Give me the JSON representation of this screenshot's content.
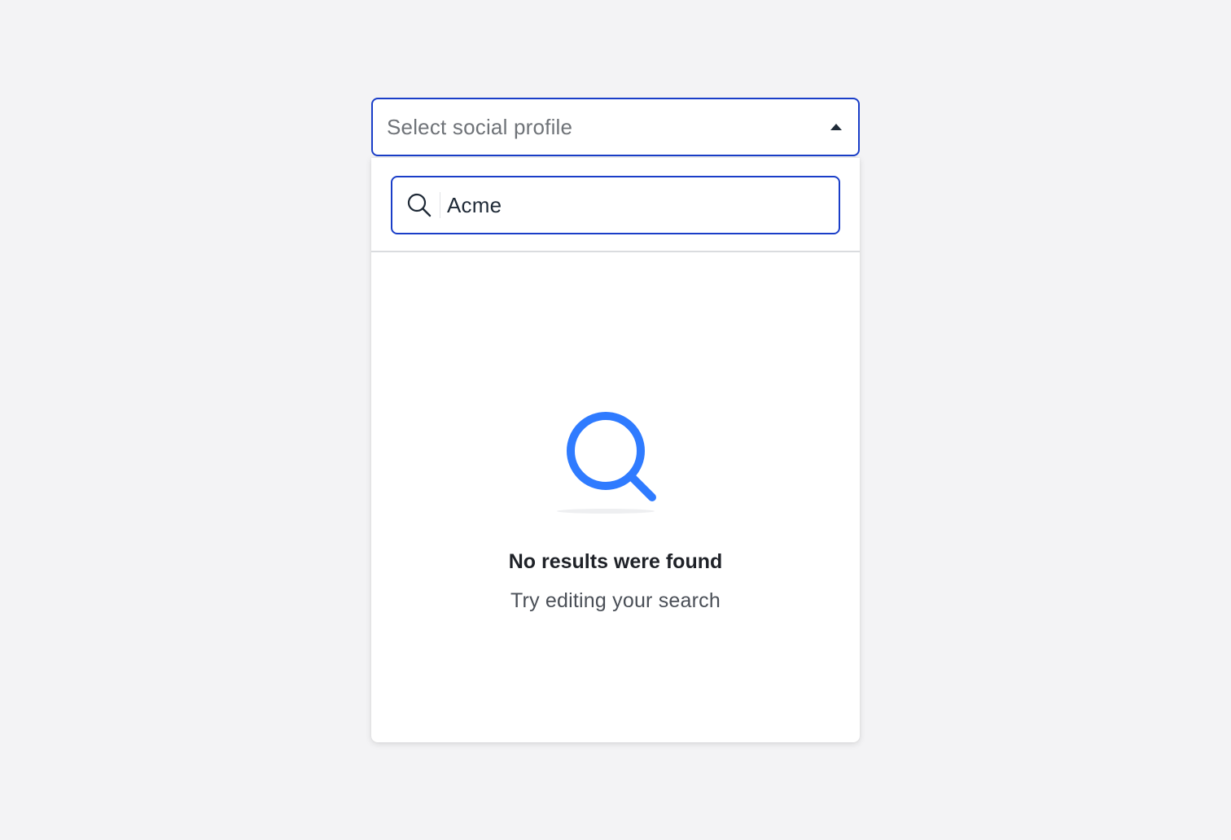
{
  "select": {
    "placeholder": "Select social profile",
    "caret_icon": "caret-up-icon"
  },
  "search": {
    "value": "Acme",
    "icon": "search-icon"
  },
  "empty_state": {
    "icon": "magnifier-illustration-icon",
    "title": "No results were found",
    "subtitle": "Try editing your search"
  },
  "colors": {
    "accent": "#1a3ec8",
    "illustration": "#2f7bff",
    "background": "#f3f3f5"
  }
}
